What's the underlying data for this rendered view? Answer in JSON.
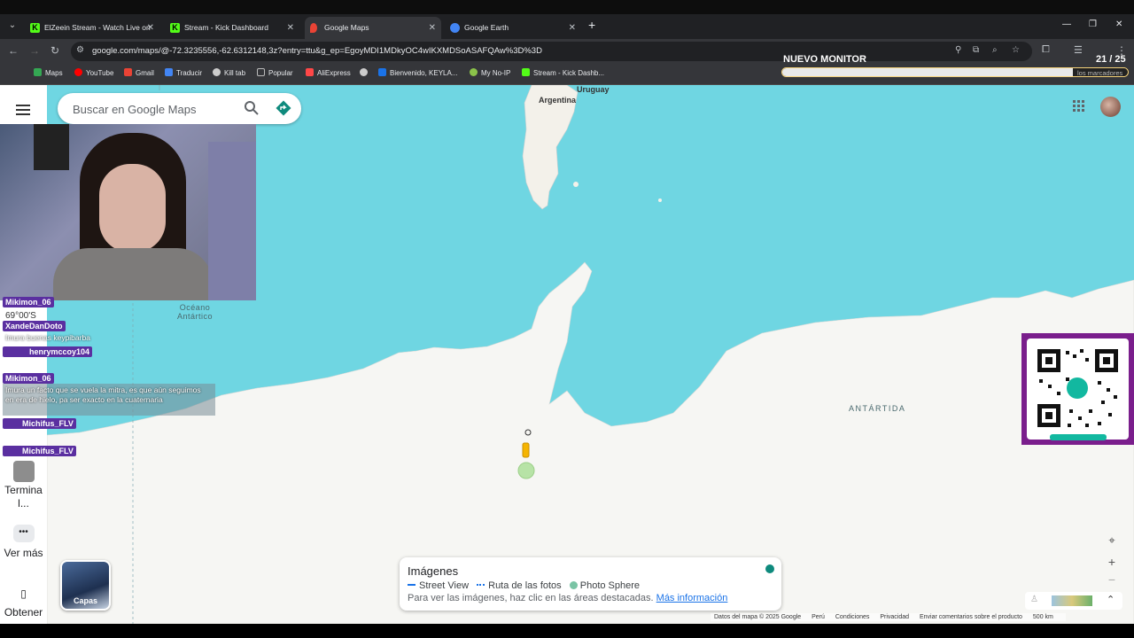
{
  "browser": {
    "tabs": [
      {
        "label": "ElZeein Stream - Watch Live on",
        "favicon": "kick-icon",
        "color": "#53fc18"
      },
      {
        "label": "Stream - Kick Dashboard",
        "favicon": "kick-icon",
        "color": "#53fc18"
      },
      {
        "label": "Google Maps",
        "favicon": "maps-pin-icon",
        "color": "#ea4335"
      },
      {
        "label": "Google Earth",
        "favicon": "earth-icon",
        "color": "#4285f4"
      }
    ],
    "url": "google.com/maps/@-72.3235556,-62.6312148,3z?entry=ttu&g_ep=EgoyMDI1MDkyOC4wIKXMDSoASAFQAw%3D%3D",
    "bookmarks": [
      {
        "label": "Maps",
        "color": "#34a853"
      },
      {
        "label": "YouTube",
        "color": "#ff0000"
      },
      {
        "label": "Gmail",
        "color": "#ea4335"
      },
      {
        "label": "Traducir",
        "color": "#4285f4"
      },
      {
        "label": "Kill tab",
        "color": "#cccccc"
      },
      {
        "label": "Popular",
        "color": "#9aa0a6"
      },
      {
        "label": "AliExpress",
        "color": "#ff4747"
      },
      {
        "label": "",
        "color": "#cccccc"
      },
      {
        "label": "Bienvenido, KEYLA...",
        "color": "#1a73e8"
      },
      {
        "label": "My No-IP",
        "color": "#8bc34a"
      },
      {
        "label": "Stream - Kick Dashb...",
        "color": "#53fc18"
      }
    ]
  },
  "overlay": {
    "title": "NUEVO MONITOR",
    "count": "21 / 25",
    "progress": 0.84,
    "marcadores": "los marcadores"
  },
  "maps": {
    "search_placeholder": "Buscar en Google Maps",
    "rail": {
      "terminal_label": "Termina l...",
      "more_label": "Ver más",
      "get_label": "Obtener"
    },
    "layers_label": "Capas",
    "place_labels": {
      "uruguay": "Uruguay",
      "argentina": "Argentina",
      "oceano": "Océano Antártico",
      "antartida": "ANTÁRTIDA",
      "coord": "69°00'S"
    },
    "images_card": {
      "title": "Imágenes",
      "street_view": "Street View",
      "route": "Ruta de las fotos",
      "photo_sphere": "Photo Sphere",
      "hint": "Para ver las imágenes, haz clic en las áreas destacadas.",
      "more_info": "Más información"
    },
    "footer": {
      "data": "Datos del mapa © 2025 Google",
      "country": "Perú",
      "terms": "Condiciones",
      "privacy": "Privacidad",
      "feedback": "Enviar comentarios sobre el producto",
      "scale": "500 km"
    }
  },
  "chat": [
    {
      "user": "Mikimon_06",
      "text": ""
    },
    {
      "user": "XandeDanDoto",
      "text": "Imura buenas keypibarba"
    },
    {
      "user": "henrymccoy104",
      "text": ""
    },
    {
      "user": "Mikimon_06",
      "text": "Imura un facto que se vuela la mitra, es que aún seguimos en era de hielo, pa ser exacto en la cuaternaria"
    },
    {
      "user": "Michifus_FLV",
      "text": ""
    },
    {
      "user": "Michifus_FLV",
      "text": ""
    }
  ]
}
